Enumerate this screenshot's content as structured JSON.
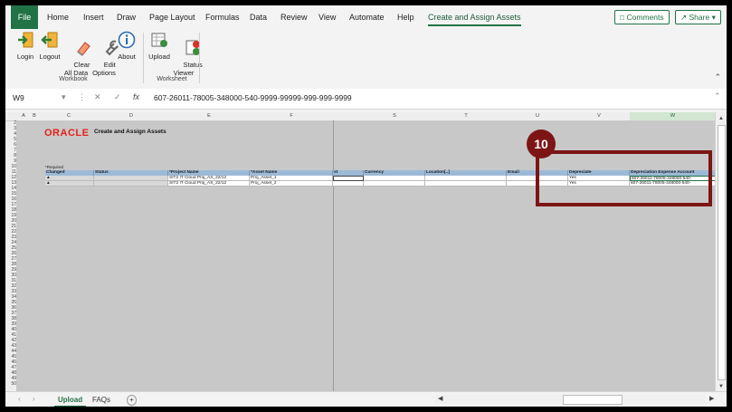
{
  "ribbon_tabs": [
    "File",
    "Home",
    "Insert",
    "Draw",
    "Page Layout",
    "Formulas",
    "Data",
    "Review",
    "View",
    "Automate",
    "Help",
    "Create and Assign Assets"
  ],
  "top_buttons": {
    "comments": "Comments",
    "share": "Share"
  },
  "workbook_group": {
    "label": "Workbook",
    "buttons": [
      {
        "label": "Login",
        "icon": "login-icon"
      },
      {
        "label": "Logout",
        "icon": "logout-icon"
      },
      {
        "label": "Clear\nAll Data",
        "icon": "eraser-icon"
      },
      {
        "label": "Edit\nOptions",
        "icon": "wrench-icon"
      },
      {
        "label": "About",
        "icon": "info-icon"
      }
    ]
  },
  "worksheet_group": {
    "label": "Worksheet",
    "buttons": [
      {
        "label": "Upload",
        "icon": "upload-icon"
      },
      {
        "label": "Status\nViewer",
        "icon": "status-viewer-icon"
      }
    ]
  },
  "formula_bar": {
    "cell": "W9",
    "fx": "fx",
    "value": "607-26011-78005-348000-540-9999-99999-999-999-9999"
  },
  "sheet": {
    "columns": [
      "A",
      "B",
      "C",
      "D",
      "E",
      "F",
      "",
      "S",
      "T",
      "U",
      "V",
      "W"
    ],
    "logo": "ORACLE",
    "title": "Create and Assign Assets",
    "required_note": "*Required",
    "headers": [
      "Changed",
      "Status",
      "*Project Name",
      "*Asset Name",
      "st",
      "Currency",
      "Location[..]",
      "Email",
      "Depreciate",
      "Depreciation Expense Account"
    ],
    "rows": [
      [
        "▲",
        "",
        "SIT2 IT Cloud Proj_AS_22/12",
        "Proj_Asset_1",
        "",
        "",
        "",
        "",
        "Yes",
        "607-26011-78005-348000-540-"
      ],
      [
        "▲",
        "",
        "SIT2 IT Cloud Proj_AS_22/12",
        "Proj_Asset_2",
        "",
        "",
        "",
        "",
        "Yes",
        "607-26011-78005-348000-540-"
      ]
    ],
    "row_numbers": [
      "2",
      "3",
      "4",
      "5",
      "6",
      "7",
      "8",
      "9",
      "10",
      "11",
      "12",
      "13",
      "14",
      "15",
      "16",
      "17",
      "18",
      "19",
      "20",
      "21",
      "22",
      "23",
      "24",
      "25",
      "26",
      "27",
      "28",
      "29",
      "30",
      "31",
      "32",
      "33",
      "34",
      "35",
      "36",
      "37",
      "38",
      "39",
      "40",
      "41",
      "42",
      "43",
      "44",
      "45",
      "46",
      "47",
      "48",
      "49",
      "50"
    ]
  },
  "callout": {
    "number": "10",
    "color": "#7d1515"
  },
  "sheet_tabs": [
    "Upload",
    "FAQs"
  ],
  "add_sheet": "+"
}
